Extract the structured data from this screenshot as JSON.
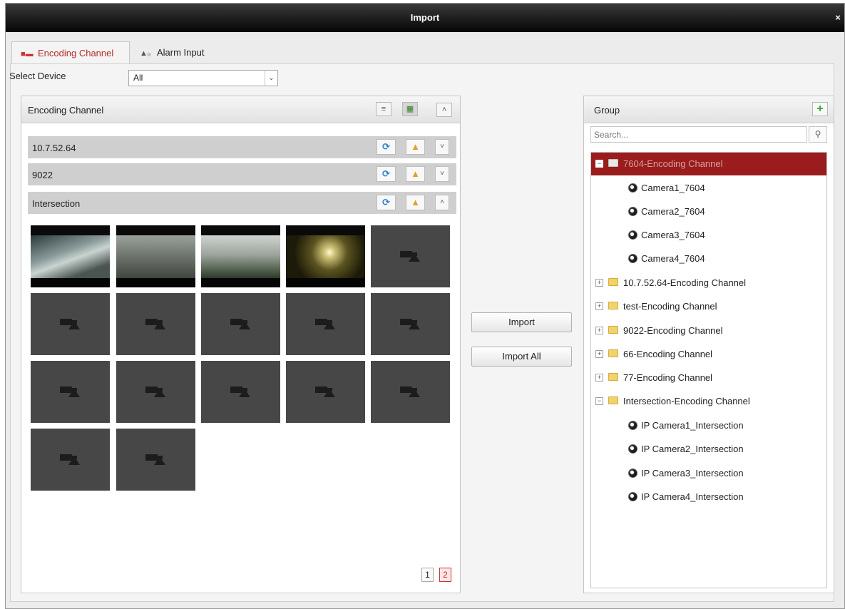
{
  "window": {
    "title": "Import",
    "close_glyph": "×"
  },
  "tabs": [
    {
      "label": "Encoding Channel",
      "icon": "camera-icon",
      "active": true
    },
    {
      "label": "Alarm Input",
      "icon": "alarm-input-icon",
      "active": false
    }
  ],
  "device_select": {
    "label": "Select Device",
    "value": "All"
  },
  "left_panel": {
    "title": "Encoding Channel",
    "devices": [
      {
        "name": "10.7.52.64",
        "expanded": false
      },
      {
        "name": "9022",
        "expanded": false
      },
      {
        "name": "Intersection",
        "expanded": true
      }
    ],
    "thumbnails": {
      "live_count": 4,
      "placeholder_count": 13
    },
    "pages": [
      "1",
      "2"
    ],
    "current_page": "2"
  },
  "actions": {
    "import_label": "Import",
    "import_all_label": "Import All"
  },
  "group_panel": {
    "title": "Group",
    "search_placeholder": "Search...",
    "tree": [
      {
        "label": "7604-Encoding Channel",
        "type": "group",
        "expanded": true,
        "selected": true,
        "children": [
          "Camera1_7604",
          "Camera2_7604",
          "Camera3_7604",
          "Camera4_7604"
        ]
      },
      {
        "label": "10.7.52.64-Encoding Channel",
        "type": "group",
        "expanded": false
      },
      {
        "label": "test-Encoding Channel",
        "type": "group",
        "expanded": false
      },
      {
        "label": "9022-Encoding Channel",
        "type": "group",
        "expanded": false
      },
      {
        "label": "66-Encoding Channel",
        "type": "group",
        "expanded": false
      },
      {
        "label": "77-Encoding Channel",
        "type": "group",
        "expanded": false
      },
      {
        "label": "Intersection-Encoding Channel",
        "type": "group",
        "expanded": true,
        "children": [
          "IP Camera1_Intersection",
          "IP Camera2_Intersection",
          "IP Camera3_Intersection",
          "IP Camera4_Intersection"
        ]
      }
    ]
  },
  "colors": {
    "selected_row": "#9a1c1c",
    "active_tab_text": "#b52b2b",
    "add_button": "#2ea52e"
  }
}
